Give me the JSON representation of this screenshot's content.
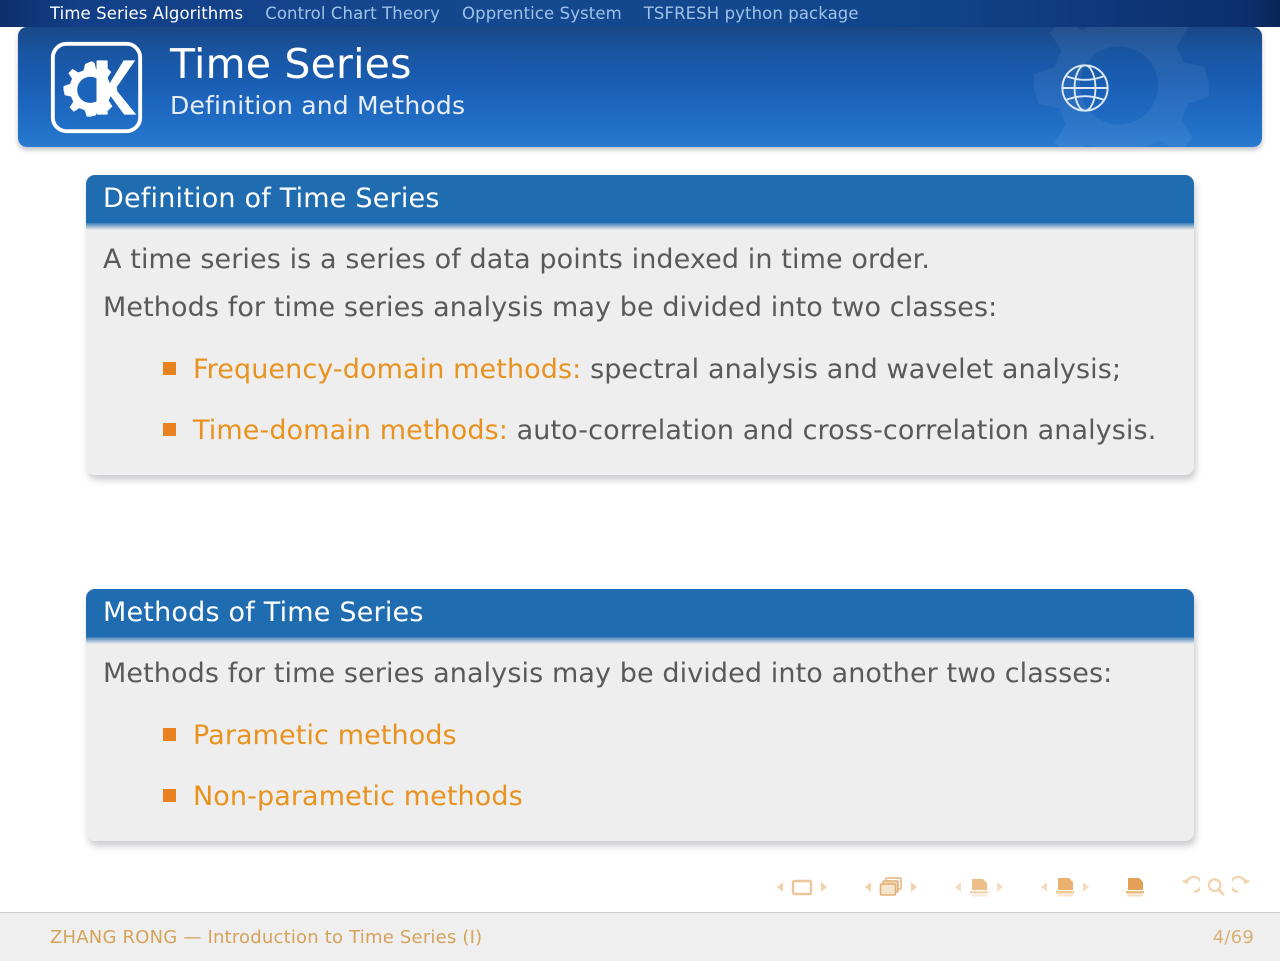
{
  "navbar": {
    "sections": [
      {
        "label": "Time Series Algorithms",
        "active": true
      },
      {
        "label": "Control Chart Theory",
        "active": false
      },
      {
        "label": "Opprentice System",
        "active": false
      },
      {
        "label": "TSFRESH python package",
        "active": false
      }
    ]
  },
  "header": {
    "logo": "kde-logo",
    "globe": "globe-icon",
    "title": "Time Series",
    "subtitle": "Definition and Methods"
  },
  "blocks": [
    {
      "title": "Definition of Time Series",
      "paragraphs": [
        "A time series is a series of data points indexed in time order.",
        "Methods for time series analysis may be divided into two classes:"
      ],
      "items": [
        {
          "highlight": "Frequency-domain methods:",
          "rest": " spectral analysis and wavelet analysis;"
        },
        {
          "highlight": "Time-domain methods:",
          "rest": " auto-correlation and cross-correlation analysis."
        }
      ]
    },
    {
      "title": "Methods of Time Series",
      "paragraphs": [
        "Methods for time series analysis may be divided into another two classes:"
      ],
      "items": [
        {
          "highlight": "Parametic methods",
          "rest": ""
        },
        {
          "highlight": "Non-parametic methods",
          "rest": ""
        }
      ]
    }
  ],
  "navsymbols": {
    "slide": "slide-icon",
    "frame": "frame-icon",
    "subsection": "subsection-icon",
    "section": "section-icon",
    "document": "document-icon",
    "back": "back-icon",
    "search": "search-icon",
    "forward": "forward-icon",
    "prev": "prev-triangle-icon",
    "next": "next-triangle-icon"
  },
  "footer": {
    "author_title": "ZHANG RONG — Introduction to Time Series (I)",
    "page": "4/69"
  },
  "colors": {
    "navbar_blue": "#123f88",
    "header_blue": "#1c63bb",
    "block_title_blue": "#1f6cb0",
    "block_body_gray": "#efeeee",
    "text_gray": "#595959",
    "accent_orange": "#e8921f",
    "bullet_orange": "#e8821e",
    "footer_gold": "#d4a259"
  }
}
